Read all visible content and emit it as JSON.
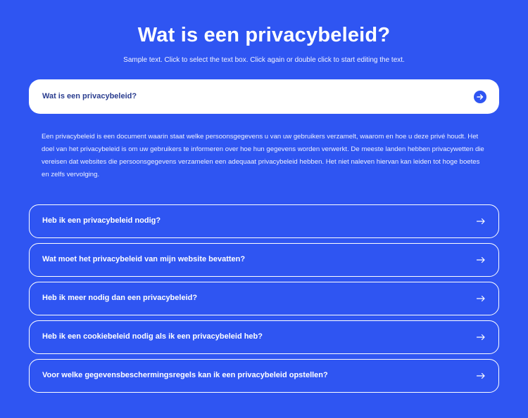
{
  "header": {
    "title": "Wat is een privacybeleid?",
    "subtitle": "Sample text. Click to select the text box. Click again or double click to start editing the text."
  },
  "faq": {
    "open_item": {
      "question": "Wat is een privacybeleid?",
      "answer": "Een privacybeleid is een document waarin staat welke persoonsgegevens u van uw gebruikers verzamelt, waarom en hoe u deze privé houdt. Het doel van het privacybeleid is om uw gebruikers te informeren over hoe hun gegevens worden verwerkt. De meeste landen hebben privacywetten die vereisen dat websites die persoonsgegevens verzamelen een adequaat privacybeleid hebben. Het niet naleven hiervan kan leiden tot hoge boetes en zelfs vervolging.",
      "icon": "arrow-right-circle-icon"
    },
    "items": [
      {
        "question": "Heb ik een privacybeleid nodig?",
        "icon": "arrow-right-icon"
      },
      {
        "question": "Wat moet het privacybeleid van mijn website bevatten?",
        "icon": "arrow-right-icon"
      },
      {
        "question": "Heb ik meer nodig dan een privacybeleid?",
        "icon": "arrow-right-icon"
      },
      {
        "question": "Heb ik een cookiebeleid nodig als ik een privacybeleid heb?",
        "icon": "arrow-right-icon"
      },
      {
        "question": "Voor welke gegevensbeschermingsregels kan ik een privacybeleid opstellen?",
        "icon": "arrow-right-icon"
      }
    ]
  },
  "colors": {
    "background": "#2f55f2",
    "open_card_bg": "#ffffff",
    "open_question_text": "#2a3d8f",
    "text": "#ffffff"
  }
}
